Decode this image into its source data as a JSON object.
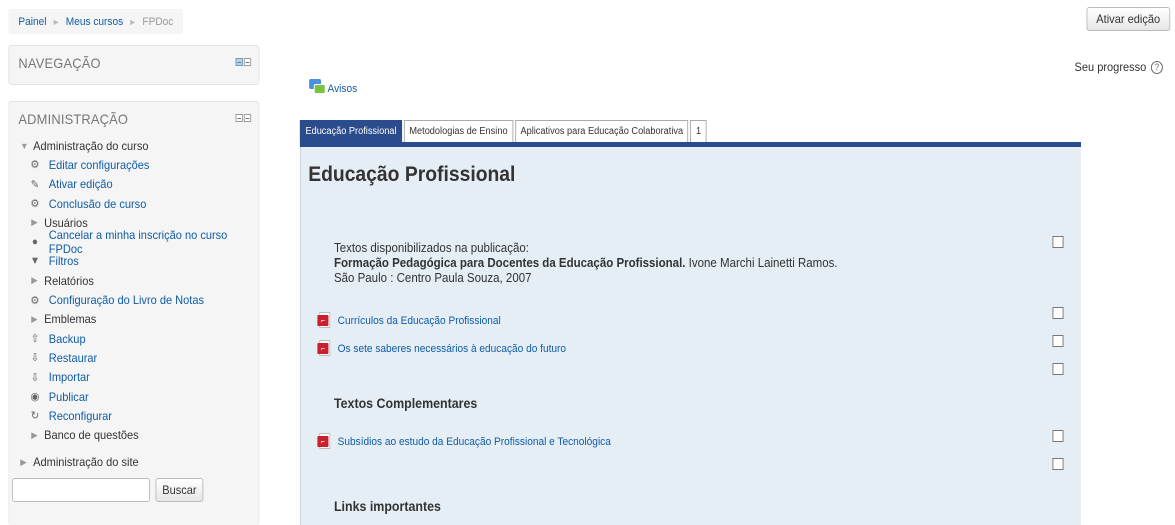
{
  "breadcrumb": {
    "home": "Painel",
    "my_courses": "Meus cursos",
    "current": "FPDoc"
  },
  "header": {
    "edit_button": "Ativar edição"
  },
  "nav_block": {
    "title": "NAVEGAÇÃO"
  },
  "admin_block": {
    "title": "ADMINISTRAÇÃO",
    "course_admin": "Administração do curso",
    "items": [
      {
        "label": "Editar configurações",
        "icon": "gear-icon"
      },
      {
        "label": "Ativar edição",
        "icon": "pencil-icon"
      },
      {
        "label": "Conclusão de curso",
        "icon": "gear-icon"
      },
      {
        "label": "Usuários",
        "icon": "expand-icon"
      },
      {
        "label": "Cancelar a minha inscrição no curso FPDoc",
        "icon": "user-icon"
      },
      {
        "label": "Filtros",
        "icon": "filter-icon"
      },
      {
        "label": "Relatórios",
        "icon": "expand-icon"
      },
      {
        "label": "Configuração do Livro de Notas",
        "icon": "gear-icon"
      },
      {
        "label": "Emblemas",
        "icon": "expand-icon"
      },
      {
        "label": "Backup",
        "icon": "upload-icon"
      },
      {
        "label": "Restaurar",
        "icon": "download-icon"
      },
      {
        "label": "Importar",
        "icon": "download-icon"
      },
      {
        "label": "Publicar",
        "icon": "globe-icon"
      },
      {
        "label": "Reconfigurar",
        "icon": "refresh-icon"
      },
      {
        "label": "Banco de questões",
        "icon": "expand-icon"
      }
    ],
    "site_admin": "Administração do site",
    "search_button": "Buscar"
  },
  "progress": {
    "label": "Seu progresso",
    "help": "?"
  },
  "forum": {
    "label": "Avisos"
  },
  "tabs": [
    "Educação Profissional",
    "Metodologias de Ensino",
    "Aplicativos para Educação Colaborativa",
    "1"
  ],
  "section": {
    "title": "Educação Profissional",
    "intro_line1": "Textos disponibilizados na publicação:",
    "intro_bold": "Formação Pedagógica para Docentes da Educação Profissional.",
    "intro_author": " Ivone Marchi Lainetti Ramos.",
    "intro_line3": "São Paulo : Centro Paula Souza, 2007",
    "resource1": "Currículos da Educação Profissional",
    "resource2": "Os sete saberes necessários à educação do futuro",
    "complementary_heading": "Textos Complementares",
    "resource3": "Subsídios ao estudo da Educação Profissional e Tecnológica",
    "links_heading": "Links importantes"
  }
}
